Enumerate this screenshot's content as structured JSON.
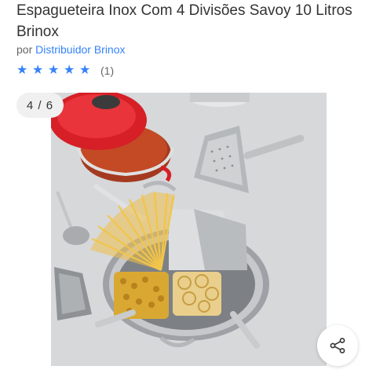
{
  "product": {
    "title": "Espagueteira Inox Com 4 Divisões Savoy 10 Litros Brinox",
    "seller_prefix": "por",
    "seller_name": "Distribuidor Brinox",
    "rating_stars": 5,
    "review_count": "(1)"
  },
  "gallery": {
    "counter": "4 / 6",
    "current": 4,
    "total": 6
  },
  "icons": {
    "star": "star-icon",
    "share": "share-icon"
  },
  "colors": {
    "accent": "#3483fa",
    "text": "#333333"
  }
}
